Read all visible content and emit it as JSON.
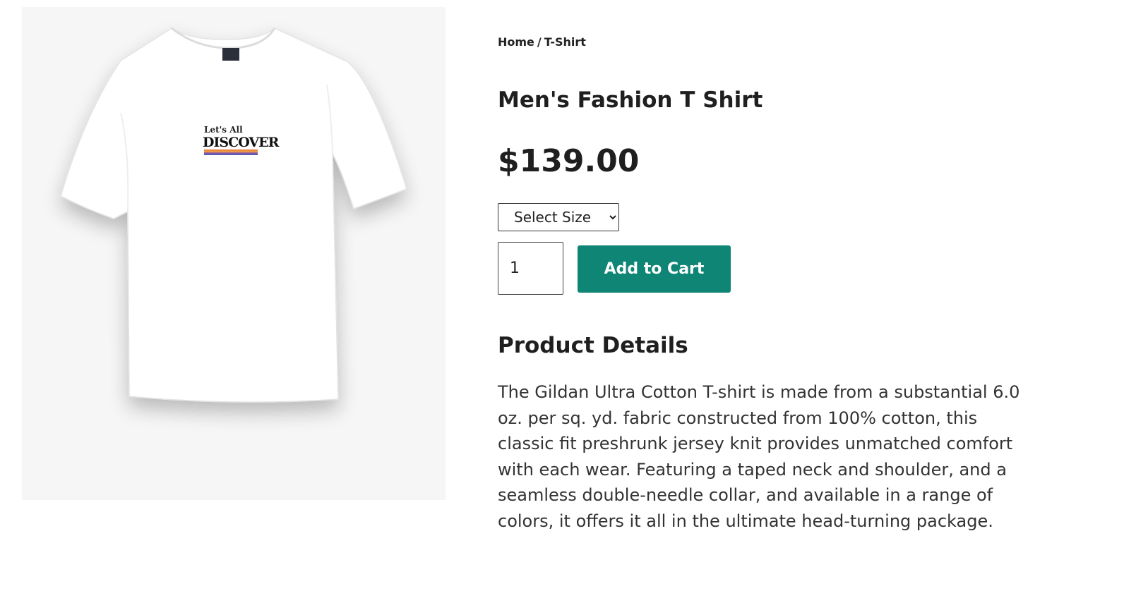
{
  "breadcrumb": {
    "home_label": "Home",
    "separator": "/",
    "current_label": "T-Shirt"
  },
  "product": {
    "title": "Men's Fashion T Shirt",
    "price": "$139.00",
    "image_alt_graphic": {
      "line1": "Let's All",
      "line2": "DISCOVER"
    },
    "size_select": {
      "selected": "Select Size"
    },
    "quantity": "1",
    "add_to_cart_label": "Add to Cart",
    "details_heading": "Product Details",
    "description": "The Gildan Ultra Cotton T-shirt is made from a substantial 6.0 oz. per sq. yd. fabric constructed from 100% cotton, this classic fit preshrunk jersey knit provides unmatched comfort with each wear. Featuring a taped neck and shoulder, and a seamless double-needle collar, and available in a range of colors, it offers it all in the ultimate head-turning package."
  },
  "colors": {
    "accent": "#0f8575",
    "text": "#1f1f1f",
    "image_background": "#f6f6f6"
  },
  "icons": {
    "select_arrow": "chevron-down-icon"
  }
}
